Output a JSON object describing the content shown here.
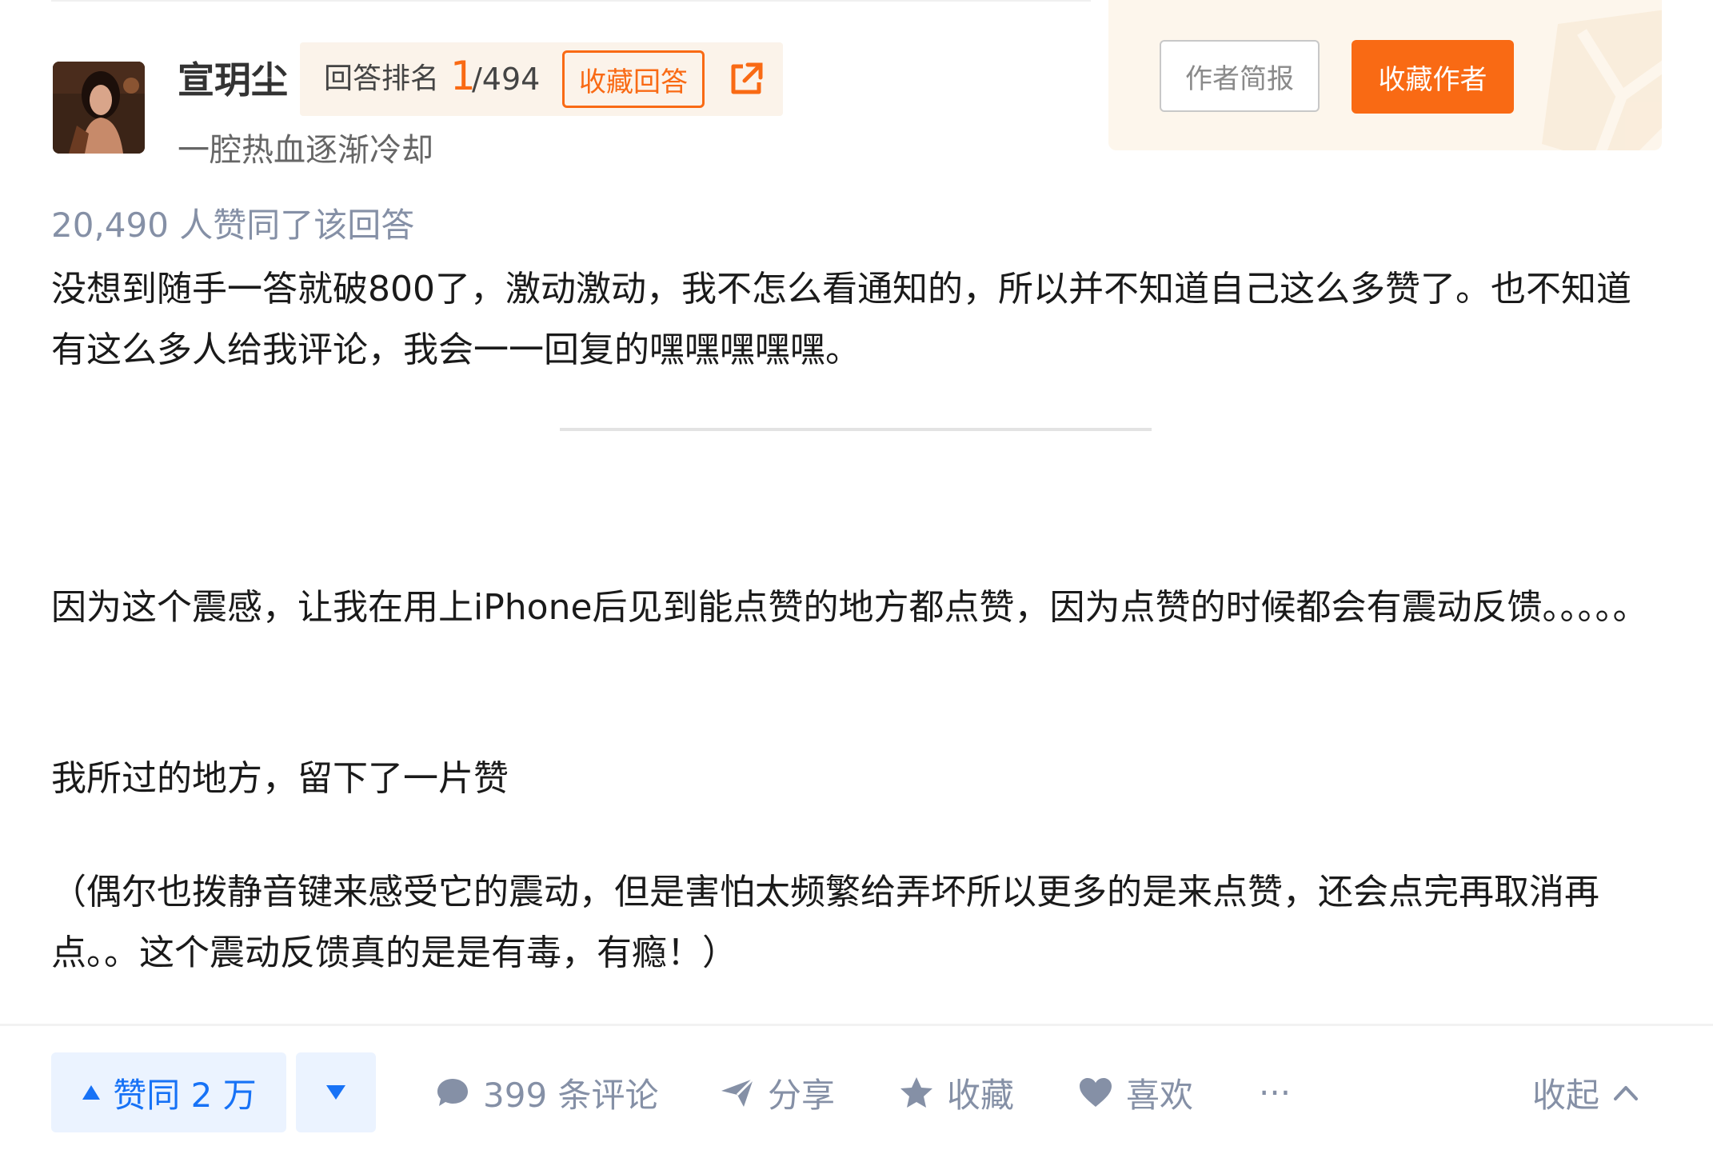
{
  "author": {
    "name": "宣玥尘",
    "tagline": "一腔热血逐渐冷却",
    "rank_label": "回答排名",
    "rank": "1",
    "rank_total": "/494",
    "collect_answer_label": "收藏回答",
    "profile_button": "作者简报",
    "follow_button": "收藏作者"
  },
  "answer": {
    "votes_text": "20,490 人赞同了该回答",
    "paragraphs": [
      "没想到随手一答就破800了，激动激动，我不怎么看通知的，所以并不知道自己这么多赞了。也不知道有这么多人给我评论，我会一一回复的嘿嘿嘿嘿嘿。",
      "因为这个震感，让我在用上iPhone后见到能点赞的地方都点赞，因为点赞的时候都会有震动反馈。。。。。",
      "我所过的地方，留下了一片赞",
      "（偶尔也拨静音键来感受它的震动，但是害怕太频繁给弄坏所以更多的是来点赞，还会点完再取消再点。。这个震动反馈真的是是有毒，有瘾！）"
    ]
  },
  "actions": {
    "vote_up": "赞同 2 万",
    "comments": "399 条评论",
    "share": "分享",
    "favorite": "收藏",
    "like": "喜欢",
    "more": "···",
    "collapse": "收起"
  },
  "colors": {
    "accent_orange": "#f96a14",
    "accent_blue": "#1772f6",
    "muted": "#8590a6"
  },
  "icons": [
    "share-out-icon",
    "caret-up-icon",
    "caret-down-icon",
    "comment-icon",
    "send-icon",
    "star-icon",
    "heart-icon",
    "chevron-up-icon"
  ]
}
